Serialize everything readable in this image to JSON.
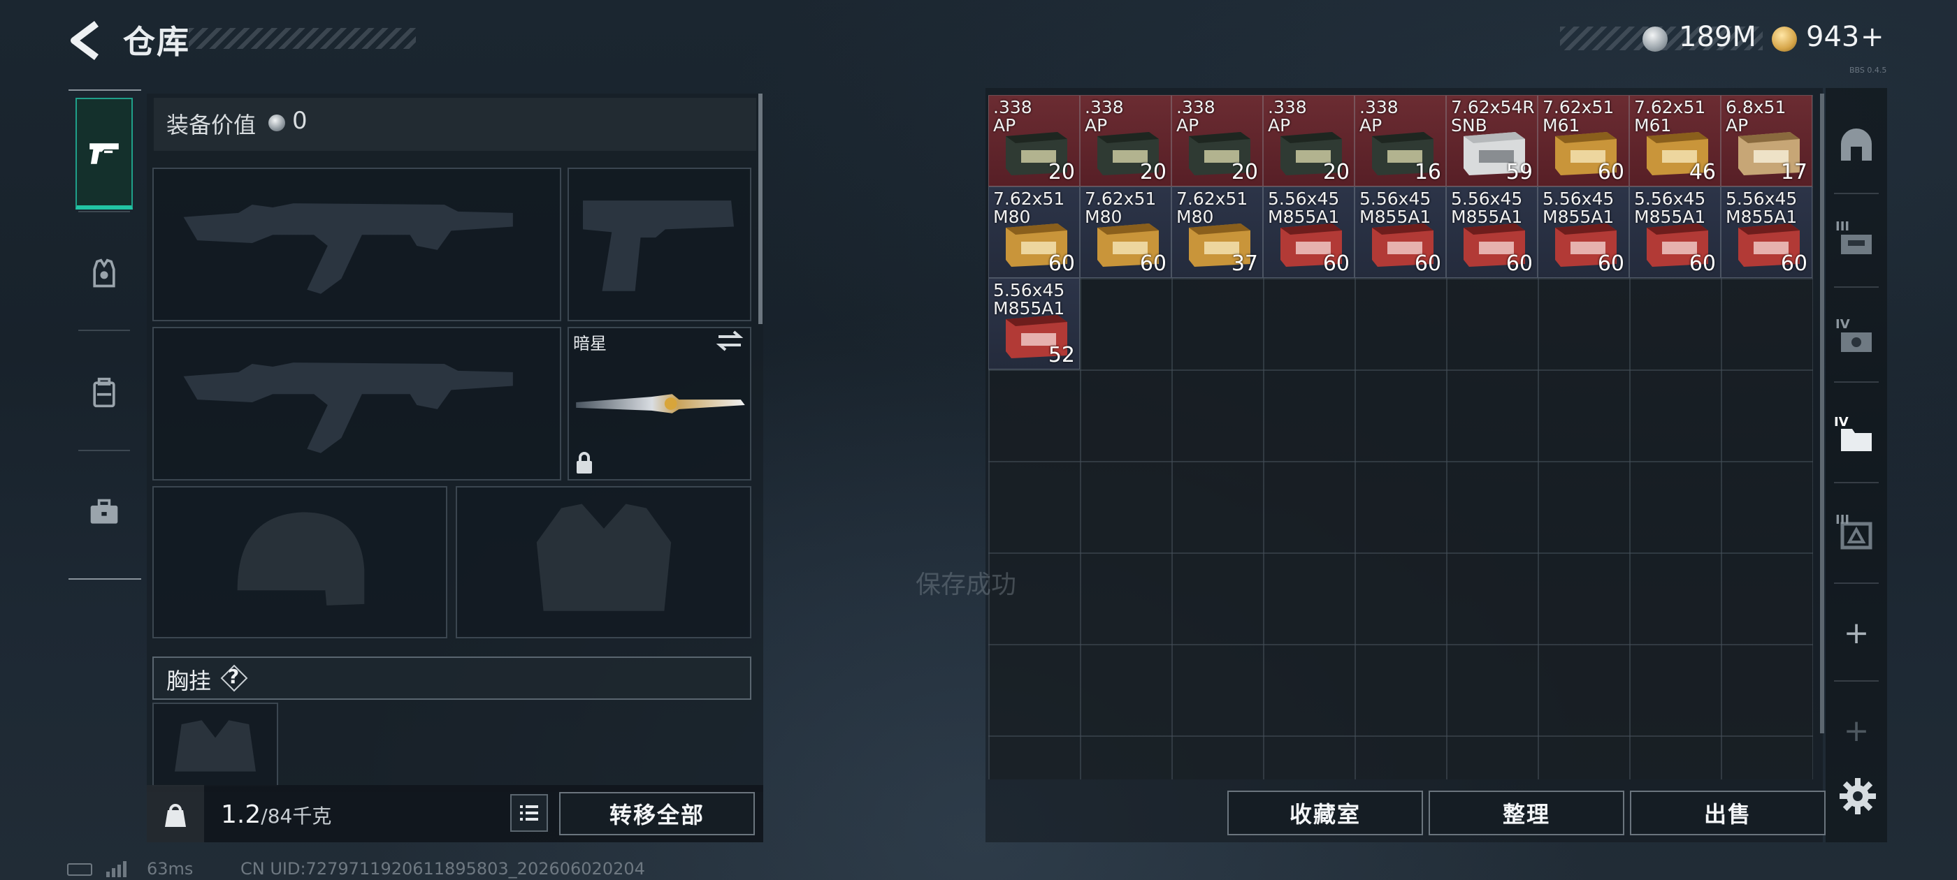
{
  "header": {
    "title": "仓库",
    "currency_silver": "189M",
    "currency_gold": "943",
    "gold_add": "+",
    "version": "BBS 0.4.5"
  },
  "equipment": {
    "value_label": "装备价值",
    "value": "0",
    "knife_name": "暗星",
    "chest_label": "胸挂",
    "help": "?"
  },
  "weight": {
    "current": "1.2",
    "capacity": "/84千克"
  },
  "buttons": {
    "transfer_all": "转移全部",
    "collection": "收藏室",
    "sort": "整理",
    "sell": "出售"
  },
  "toast": "保存成功",
  "status": {
    "ping": "63ms",
    "uid": "CN UID:7279711920611895803_202606020204"
  },
  "right_rail": {
    "tab_labels": [
      "III",
      "IV",
      "IV",
      "III"
    ],
    "plus": "+"
  },
  "colors": {
    "accent": "#22c4a4",
    "rarity_red": "#6b2c32",
    "rarity_blue": "#2c3448"
  },
  "items": [
    {
      "caliber": ".338\nAP",
      "count": "20",
      "rarity": "red",
      "box": "dark"
    },
    {
      "caliber": ".338\nAP",
      "count": "20",
      "rarity": "red",
      "box": "dark"
    },
    {
      "caliber": ".338\nAP",
      "count": "20",
      "rarity": "red",
      "box": "dark"
    },
    {
      "caliber": ".338\nAP",
      "count": "20",
      "rarity": "red",
      "box": "dark"
    },
    {
      "caliber": ".338\nAP",
      "count": "16",
      "rarity": "red",
      "box": "dark"
    },
    {
      "caliber": "7.62x54R\nSNB",
      "count": "59",
      "rarity": "red",
      "box": "white"
    },
    {
      "caliber": "7.62x51\nM61",
      "count": "60",
      "rarity": "red",
      "box": "gold"
    },
    {
      "caliber": "7.62x51\nM61",
      "count": "46",
      "rarity": "red",
      "box": "gold"
    },
    {
      "caliber": "6.8x51\nAP",
      "count": "17",
      "rarity": "red",
      "box": "tan"
    },
    {
      "caliber": "7.62x51\nM80",
      "count": "60",
      "rarity": "blue",
      "box": "gold"
    },
    {
      "caliber": "7.62x51\nM80",
      "count": "60",
      "rarity": "blue",
      "box": "gold"
    },
    {
      "caliber": "7.62x51\nM80",
      "count": "37",
      "rarity": "blue",
      "box": "gold"
    },
    {
      "caliber": "5.56x45\nM855A1",
      "count": "60",
      "rarity": "blue",
      "box": "redbox"
    },
    {
      "caliber": "5.56x45\nM855A1",
      "count": "60",
      "rarity": "blue",
      "box": "redbox"
    },
    {
      "caliber": "5.56x45\nM855A1",
      "count": "60",
      "rarity": "blue",
      "box": "redbox"
    },
    {
      "caliber": "5.56x45\nM855A1",
      "count": "60",
      "rarity": "blue",
      "box": "redbox"
    },
    {
      "caliber": "5.56x45\nM855A1",
      "count": "60",
      "rarity": "blue",
      "box": "redbox"
    },
    {
      "caliber": "5.56x45\nM855A1",
      "count": "60",
      "rarity": "blue",
      "box": "redbox"
    },
    {
      "caliber": "5.56x45\nM855A1",
      "count": "52",
      "rarity": "blue",
      "box": "redbox"
    }
  ]
}
